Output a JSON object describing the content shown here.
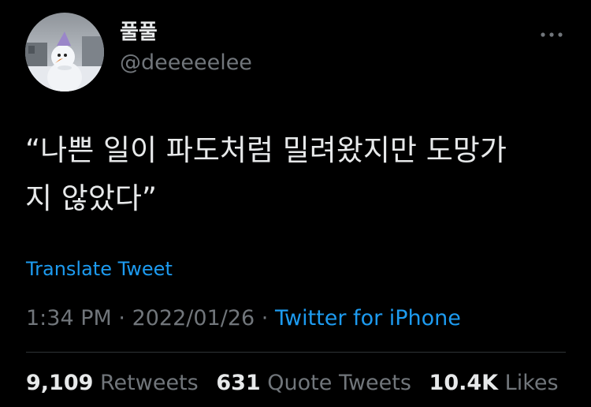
{
  "author": {
    "display_name": "풀풀",
    "handle": "@deeeeelee"
  },
  "header": {
    "more_icon": "more-horizontal-icon"
  },
  "tweet": {
    "text_lines": [
      "“나쁜 일이 파도처럼 밀려왔지만 도망가",
      "지 않았다”"
    ],
    "translate_label": "Translate Tweet",
    "time": "1:34 PM",
    "separator": "·",
    "date": "2022/01/26",
    "source": "Twitter for iPhone"
  },
  "stats": {
    "retweets_count": "9,109",
    "retweets_label": "Retweets",
    "quote_count": "631",
    "quote_label": "Quote Tweets",
    "likes_count": "10.4K",
    "likes_label": "Likes"
  },
  "colors": {
    "background": "#000000",
    "text": "#e7e9ea",
    "secondary": "#71767b",
    "link": "#1d9bf0",
    "divider": "#2f3336"
  }
}
